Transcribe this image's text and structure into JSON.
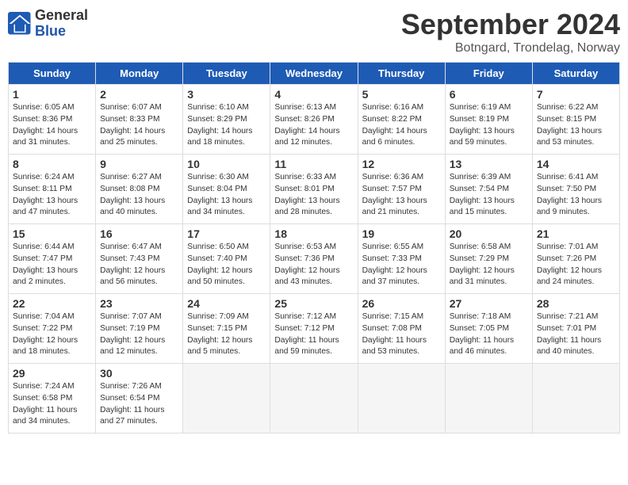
{
  "header": {
    "logo_general": "General",
    "logo_blue": "Blue",
    "month": "September 2024",
    "location": "Botngard, Trondelag, Norway"
  },
  "weekdays": [
    "Sunday",
    "Monday",
    "Tuesday",
    "Wednesday",
    "Thursday",
    "Friday",
    "Saturday"
  ],
  "weeks": [
    [
      {
        "day": "1",
        "info": "Sunrise: 6:05 AM\nSunset: 8:36 PM\nDaylight: 14 hours\nand 31 minutes."
      },
      {
        "day": "2",
        "info": "Sunrise: 6:07 AM\nSunset: 8:33 PM\nDaylight: 14 hours\nand 25 minutes."
      },
      {
        "day": "3",
        "info": "Sunrise: 6:10 AM\nSunset: 8:29 PM\nDaylight: 14 hours\nand 18 minutes."
      },
      {
        "day": "4",
        "info": "Sunrise: 6:13 AM\nSunset: 8:26 PM\nDaylight: 14 hours\nand 12 minutes."
      },
      {
        "day": "5",
        "info": "Sunrise: 6:16 AM\nSunset: 8:22 PM\nDaylight: 14 hours\nand 6 minutes."
      },
      {
        "day": "6",
        "info": "Sunrise: 6:19 AM\nSunset: 8:19 PM\nDaylight: 13 hours\nand 59 minutes."
      },
      {
        "day": "7",
        "info": "Sunrise: 6:22 AM\nSunset: 8:15 PM\nDaylight: 13 hours\nand 53 minutes."
      }
    ],
    [
      {
        "day": "8",
        "info": "Sunrise: 6:24 AM\nSunset: 8:11 PM\nDaylight: 13 hours\nand 47 minutes."
      },
      {
        "day": "9",
        "info": "Sunrise: 6:27 AM\nSunset: 8:08 PM\nDaylight: 13 hours\nand 40 minutes."
      },
      {
        "day": "10",
        "info": "Sunrise: 6:30 AM\nSunset: 8:04 PM\nDaylight: 13 hours\nand 34 minutes."
      },
      {
        "day": "11",
        "info": "Sunrise: 6:33 AM\nSunset: 8:01 PM\nDaylight: 13 hours\nand 28 minutes."
      },
      {
        "day": "12",
        "info": "Sunrise: 6:36 AM\nSunset: 7:57 PM\nDaylight: 13 hours\nand 21 minutes."
      },
      {
        "day": "13",
        "info": "Sunrise: 6:39 AM\nSunset: 7:54 PM\nDaylight: 13 hours\nand 15 minutes."
      },
      {
        "day": "14",
        "info": "Sunrise: 6:41 AM\nSunset: 7:50 PM\nDaylight: 13 hours\nand 9 minutes."
      }
    ],
    [
      {
        "day": "15",
        "info": "Sunrise: 6:44 AM\nSunset: 7:47 PM\nDaylight: 13 hours\nand 2 minutes."
      },
      {
        "day": "16",
        "info": "Sunrise: 6:47 AM\nSunset: 7:43 PM\nDaylight: 12 hours\nand 56 minutes."
      },
      {
        "day": "17",
        "info": "Sunrise: 6:50 AM\nSunset: 7:40 PM\nDaylight: 12 hours\nand 50 minutes."
      },
      {
        "day": "18",
        "info": "Sunrise: 6:53 AM\nSunset: 7:36 PM\nDaylight: 12 hours\nand 43 minutes."
      },
      {
        "day": "19",
        "info": "Sunrise: 6:55 AM\nSunset: 7:33 PM\nDaylight: 12 hours\nand 37 minutes."
      },
      {
        "day": "20",
        "info": "Sunrise: 6:58 AM\nSunset: 7:29 PM\nDaylight: 12 hours\nand 31 minutes."
      },
      {
        "day": "21",
        "info": "Sunrise: 7:01 AM\nSunset: 7:26 PM\nDaylight: 12 hours\nand 24 minutes."
      }
    ],
    [
      {
        "day": "22",
        "info": "Sunrise: 7:04 AM\nSunset: 7:22 PM\nDaylight: 12 hours\nand 18 minutes."
      },
      {
        "day": "23",
        "info": "Sunrise: 7:07 AM\nSunset: 7:19 PM\nDaylight: 12 hours\nand 12 minutes."
      },
      {
        "day": "24",
        "info": "Sunrise: 7:09 AM\nSunset: 7:15 PM\nDaylight: 12 hours\nand 5 minutes."
      },
      {
        "day": "25",
        "info": "Sunrise: 7:12 AM\nSunset: 7:12 PM\nDaylight: 11 hours\nand 59 minutes."
      },
      {
        "day": "26",
        "info": "Sunrise: 7:15 AM\nSunset: 7:08 PM\nDaylight: 11 hours\nand 53 minutes."
      },
      {
        "day": "27",
        "info": "Sunrise: 7:18 AM\nSunset: 7:05 PM\nDaylight: 11 hours\nand 46 minutes."
      },
      {
        "day": "28",
        "info": "Sunrise: 7:21 AM\nSunset: 7:01 PM\nDaylight: 11 hours\nand 40 minutes."
      }
    ],
    [
      {
        "day": "29",
        "info": "Sunrise: 7:24 AM\nSunset: 6:58 PM\nDaylight: 11 hours\nand 34 minutes."
      },
      {
        "day": "30",
        "info": "Sunrise: 7:26 AM\nSunset: 6:54 PM\nDaylight: 11 hours\nand 27 minutes."
      },
      {
        "day": "",
        "info": ""
      },
      {
        "day": "",
        "info": ""
      },
      {
        "day": "",
        "info": ""
      },
      {
        "day": "",
        "info": ""
      },
      {
        "day": "",
        "info": ""
      }
    ]
  ]
}
